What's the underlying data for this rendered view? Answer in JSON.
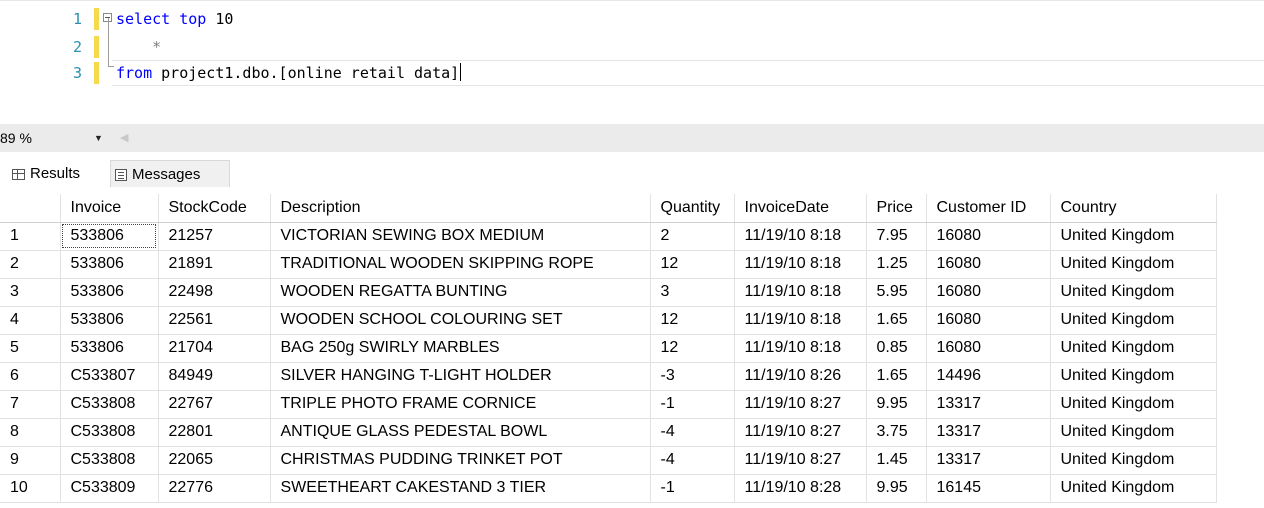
{
  "editor": {
    "lines": [
      {
        "num": "1",
        "keyword": "select top",
        "rest": " 10"
      },
      {
        "num": "2",
        "text": "    *"
      },
      {
        "num": "3",
        "keyword": "from",
        "rest": " project1.dbo.[online retail data]"
      }
    ],
    "colors": {
      "keyword": "#0000ff",
      "line_number": "#2b91af",
      "change_bar": "#f7d94c"
    }
  },
  "zoom": {
    "value": "89 %"
  },
  "tabs": {
    "results": "Results",
    "messages": "Messages"
  },
  "grid": {
    "columns": [
      "Invoice",
      "StockCode",
      "Description",
      "Quantity",
      "InvoiceDate",
      "Price",
      "Customer ID",
      "Country"
    ],
    "rows": [
      [
        "1",
        "533806",
        "21257",
        "VICTORIAN SEWING BOX MEDIUM",
        "2",
        "11/19/10 8:18",
        "7.95",
        "16080",
        "United Kingdom"
      ],
      [
        "2",
        "533806",
        "21891",
        "TRADITIONAL WOODEN SKIPPING ROPE",
        "12",
        "11/19/10 8:18",
        "1.25",
        "16080",
        "United Kingdom"
      ],
      [
        "3",
        "533806",
        "22498",
        "WOODEN REGATTA BUNTING",
        "3",
        "11/19/10 8:18",
        "5.95",
        "16080",
        "United Kingdom"
      ],
      [
        "4",
        "533806",
        "22561",
        "WOODEN SCHOOL COLOURING SET",
        "12",
        "11/19/10 8:18",
        "1.65",
        "16080",
        "United Kingdom"
      ],
      [
        "5",
        "533806",
        "21704",
        "BAG 250g SWIRLY MARBLES",
        "12",
        "11/19/10 8:18",
        "0.85",
        "16080",
        "United Kingdom"
      ],
      [
        "6",
        "C533807",
        "84949",
        "SILVER HANGING T-LIGHT HOLDER",
        "-3",
        "11/19/10 8:26",
        "1.65",
        "14496",
        "United Kingdom"
      ],
      [
        "7",
        "C533808",
        "22767",
        "TRIPLE PHOTO FRAME CORNICE",
        "-1",
        "11/19/10 8:27",
        "9.95",
        "13317",
        "United Kingdom"
      ],
      [
        "8",
        "C533808",
        "22801",
        "ANTIQUE GLASS PEDESTAL BOWL",
        "-4",
        "11/19/10 8:27",
        "3.75",
        "13317",
        "United Kingdom"
      ],
      [
        "9",
        "C533808",
        "22065",
        "CHRISTMAS PUDDING TRINKET POT",
        "-4",
        "11/19/10 8:27",
        "1.45",
        "13317",
        "United Kingdom"
      ],
      [
        "10",
        "C533809",
        "22776",
        "SWEETHEART CAKESTAND 3 TIER",
        "-1",
        "11/19/10 8:28",
        "9.95",
        "16145",
        "United Kingdom"
      ]
    ]
  }
}
